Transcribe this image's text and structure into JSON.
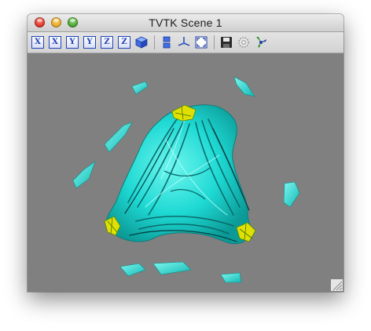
{
  "window": {
    "title": "TVTK Scene 1"
  },
  "toolbar": {
    "axis_buttons": [
      {
        "label": "X",
        "name": "view-plus-x-button"
      },
      {
        "label": "X",
        "name": "view-minus-x-button"
      },
      {
        "label": "Y",
        "name": "view-plus-y-button"
      },
      {
        "label": "Y",
        "name": "view-minus-y-button"
      },
      {
        "label": "Z",
        "name": "view-plus-z-button"
      },
      {
        "label": "Z",
        "name": "view-minus-z-button"
      }
    ],
    "icons": [
      "isometric-view-icon",
      "parallel-projection-icon",
      "axes-indicator-icon",
      "full-screen-icon",
      "save-icon",
      "configure-icon",
      "mayavi-icon"
    ]
  },
  "colors": {
    "background": "#808080",
    "surface": "#1ed6d2",
    "surface_dark": "#0a6f70",
    "highlight": "#e8e800",
    "axis_button": "#2244bb"
  }
}
